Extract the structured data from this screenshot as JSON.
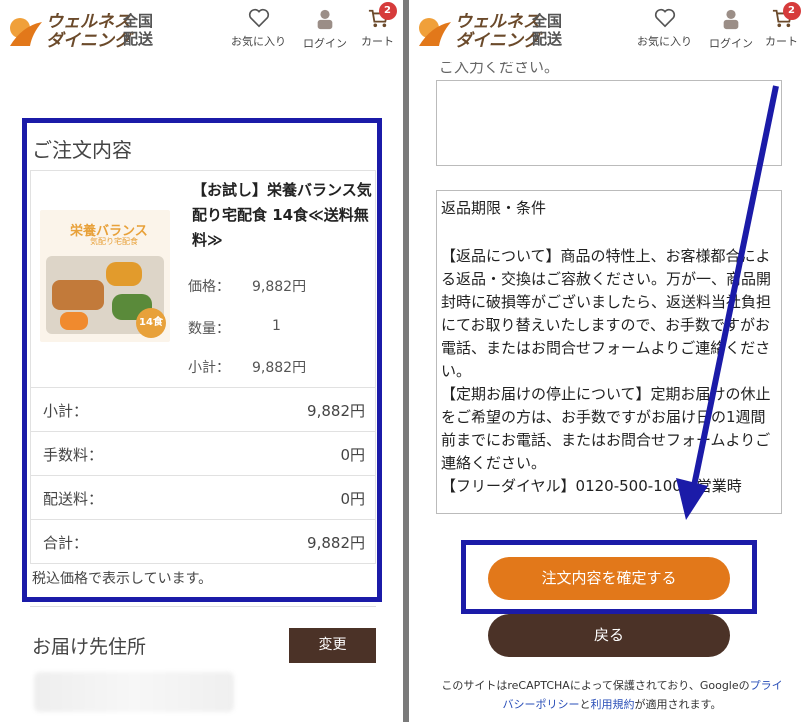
{
  "header": {
    "logo_line1": "ウェルネス",
    "logo_line2": "ダイニング",
    "logo_region": "全国配送",
    "favorites_label": "お気に入り",
    "login_label": "ログイン",
    "cart_label": "カート",
    "cart_count": "2"
  },
  "order": {
    "title": "ご注文内容",
    "product": {
      "image_tag1": "栄養バランス",
      "image_tag2": "気配り宅配食",
      "image_badge": "14食",
      "name": "【お試し】栄養バランス気配り宅配食 14食≪送料無料≫",
      "price_label": "価格：",
      "price": "9,882円",
      "qty_label": "数量：",
      "qty": "1",
      "subtotal_label": "小計：",
      "subtotal": "9,882円"
    },
    "summary": [
      {
        "label": "小計：",
        "value": "9,882円"
      },
      {
        "label": "手数料：",
        "value": "0円"
      },
      {
        "label": "配送料：",
        "value": "0円"
      },
      {
        "label": "合計：",
        "value": "9,882円"
      }
    ],
    "tax_note": "税込価格で表示しています。"
  },
  "delivery": {
    "title": "お届け先住所",
    "change_label": "変更"
  },
  "right": {
    "cut_text": "ご入力ください。",
    "return_title": "返品期限・条件",
    "return_body": "【返品について】商品の特性上、お客様都合による返品・交換はご容赦ください。万が一、商品開封時に破損等がございましたら、返送料当社負担にてお取り替えいたしますので、お手数ですがお電話、またはお問合せフォームよりご連絡ください。\n【定期お届けの停止について】定期お届けの休止をご希望の方は、お手数ですがお届け日の1週間前までにお電話、またはお問合せフォームよりご連絡ください。\n【フリーダイヤル】0120-500-100（営業時",
    "confirm_label": "注文内容を確定する",
    "back_label": "戻る",
    "recaptcha_prefix": "このサイトはreCAPTCHAによって保護されており、Googleの",
    "privacy_link": "プライバシーポリシー",
    "and": "と",
    "terms_link": "利用規約",
    "recaptcha_suffix": "が適用されます。"
  },
  "colors": {
    "highlight": "#1b1ba8",
    "confirm": "#e2781a",
    "brown": "#4b3227",
    "badge": "#d63b3b"
  }
}
